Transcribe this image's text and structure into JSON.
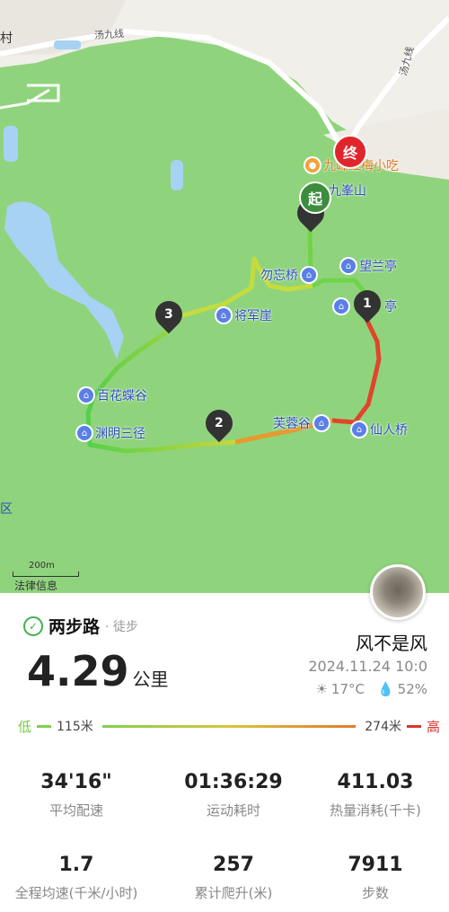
{
  "map": {
    "roads": [
      "汤九线",
      "汤九线"
    ],
    "edge_label": "村",
    "district_label": "区",
    "pois": [
      {
        "name": "九峰红梅小吃"
      },
      {
        "name": "九峯山"
      },
      {
        "name": "望兰亭"
      },
      {
        "name": "勿忘桥"
      },
      {
        "name": "将军崖"
      },
      {
        "name": "亭"
      },
      {
        "name": "百花蝶谷"
      },
      {
        "name": "芙蓉谷"
      },
      {
        "name": "仙人桥"
      },
      {
        "name": "渊明三径"
      }
    ],
    "markers": {
      "start": "起",
      "end": "终",
      "cp1": "1",
      "cp2": "2",
      "cp3": "3"
    },
    "scale": "200m",
    "legal": "法律信息",
    "colors": {
      "grass": "#8fd47d",
      "water": "#a7d2f4",
      "start": "#3d8d3f",
      "end": "#e0262c"
    }
  },
  "brand": {
    "name": "两步路",
    "type": "· 徒步"
  },
  "distance": {
    "value": "4.29",
    "unit": "公里"
  },
  "user": {
    "name": "风不是风",
    "datetime": "2024.11.24 10:0"
  },
  "weather": {
    "temp": "17°C",
    "humidity": "52%"
  },
  "elevation": {
    "low_label": "低",
    "min": "115米",
    "max": "274米",
    "high_label": "高"
  },
  "stats": [
    {
      "value": "34'16\"",
      "label": "平均配速"
    },
    {
      "value": "01:36:29",
      "label": "运动耗时"
    },
    {
      "value": "411.03",
      "label": "热量消耗(千卡)"
    },
    {
      "value": "1.7",
      "label": "全程均速(千米/小时)"
    },
    {
      "value": "257",
      "label": "累计爬升(米)"
    },
    {
      "value": "7911",
      "label": "步数"
    }
  ]
}
